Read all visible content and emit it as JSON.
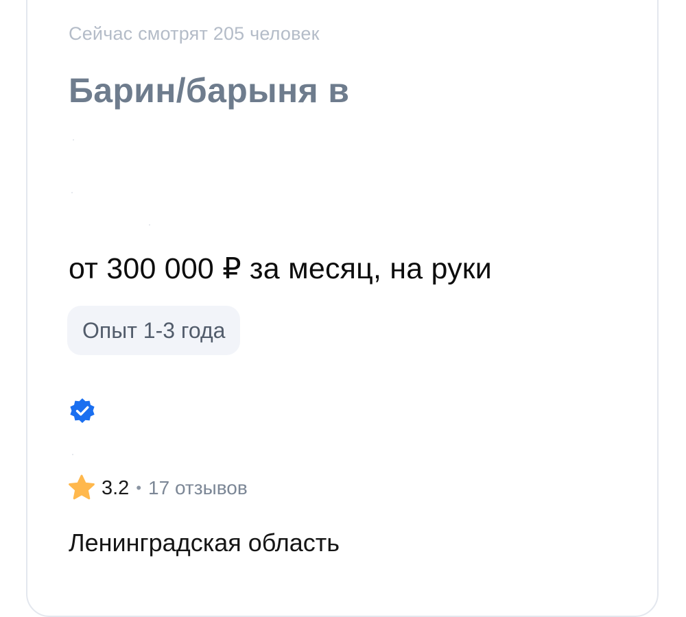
{
  "vacancy": {
    "viewers_text": "Сейчас смотрят 205 человек",
    "title": "Барин/барыня в",
    "salary": "от 300 000 ₽ за месяц, на руки",
    "experience": "Опыт 1-3 года",
    "region": "Ленинградская область"
  },
  "employer": {
    "verified_icon": "verified-badge-icon",
    "rating": "3.2",
    "rating_icon": "star-icon",
    "separator": "•",
    "reviews": "17 отзывов"
  },
  "colors": {
    "title": "#6e7c8d",
    "muted": "#b4bcc8",
    "tag_bg": "#f2f4f9",
    "verified_blue": "#1a6ff0",
    "star": "#ffb84d"
  }
}
